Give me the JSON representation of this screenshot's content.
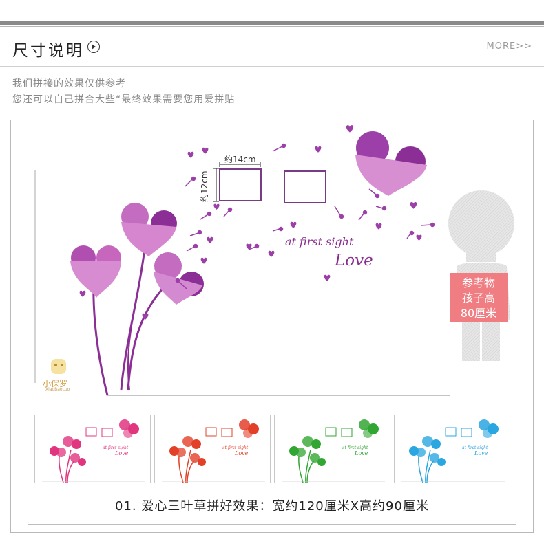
{
  "header": {
    "title": "尺寸说明",
    "more_label": "MORE>>"
  },
  "description": {
    "line1": "我们拼接的效果仅供参考",
    "line2": "您还可以自己拼合大些“最终效果需要您用爱拼贴"
  },
  "illustration": {
    "width_label": "约14cm",
    "height_label": "约12cm",
    "tagline": "at first sight",
    "love_word": "Love",
    "kid_label_lines": [
      "参考物",
      "孩子高",
      "80厘米"
    ],
    "logo_text": "小保罗",
    "logo_subtext": "XiaoBaoLuo",
    "colors": {
      "purple": "#8b2f96",
      "light_purple": "#d27ac8",
      "kid_label_bg": "#ef7d82"
    }
  },
  "thumbnails": [
    {
      "name": "pink",
      "color": "#e0357f",
      "tagline": "at first sight",
      "love": "Love"
    },
    {
      "name": "red",
      "color": "#e3402a",
      "tagline": "at first sight",
      "love": "Love"
    },
    {
      "name": "green",
      "color": "#32a632",
      "tagline": "at first sight",
      "love": "Love"
    },
    {
      "name": "blue",
      "color": "#2aa6e0",
      "tagline": "at first sight",
      "love": "Love"
    }
  ],
  "caption": "01. 爱心三叶草拼好效果：宽约120厘米X高约90厘米"
}
